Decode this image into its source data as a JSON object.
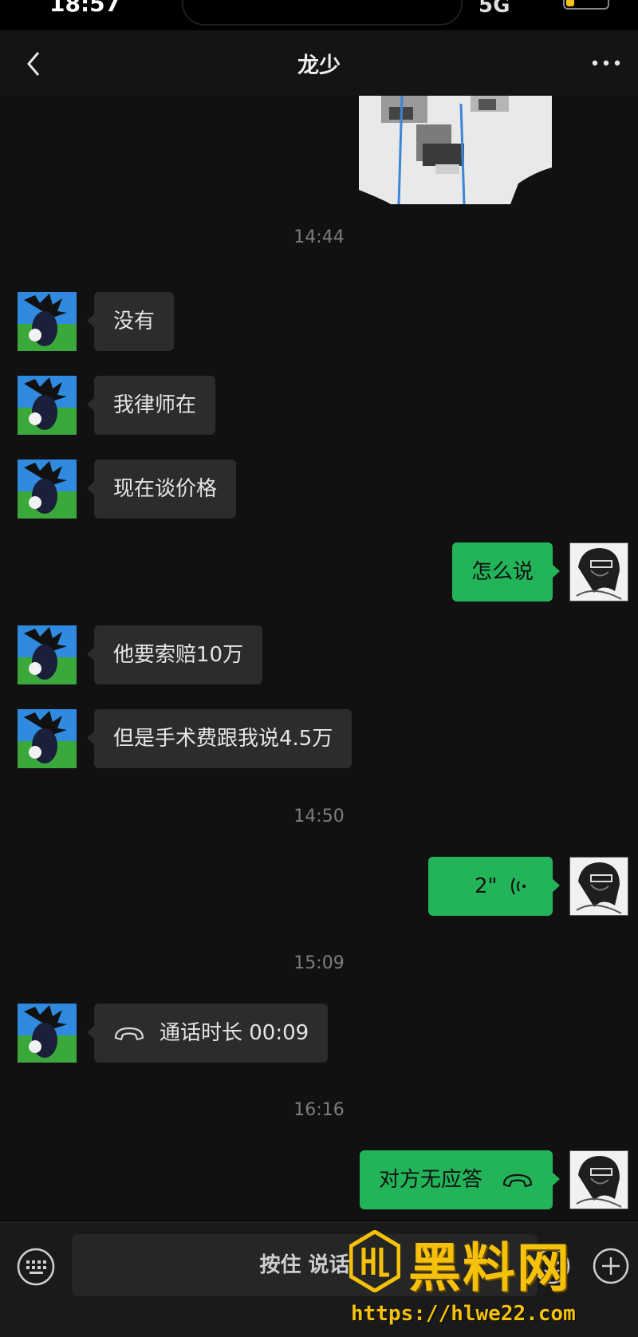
{
  "status_bar": {
    "time": "18:57",
    "network": "5G"
  },
  "header": {
    "title": "龙少"
  },
  "timestamps": [
    "14:44",
    "14:50",
    "15:09",
    "16:16"
  ],
  "messages": [
    {
      "side": "left",
      "text": "没有"
    },
    {
      "side": "left",
      "text": "我律师在"
    },
    {
      "side": "left",
      "text": "现在谈价格"
    },
    {
      "side": "right",
      "text": "怎么说"
    },
    {
      "side": "left",
      "text": "他要索赔10万"
    },
    {
      "side": "left",
      "text": "但是手术费跟我说4.5万"
    },
    {
      "side": "right",
      "type": "voice",
      "text": "2\""
    },
    {
      "side": "left",
      "type": "call",
      "text": "通话时长 00:09"
    },
    {
      "side": "right",
      "type": "call",
      "text": "对方无应答"
    }
  ],
  "input_bar": {
    "hold_to_talk": "按住 说话"
  },
  "watermark": {
    "brand": "黑料网",
    "url": "https://hlwe22.com"
  },
  "colors": {
    "bubble_self": "#23b45a",
    "bubble_other": "#2c2c2c",
    "background": "#111111",
    "watermark": "#f5c10a"
  }
}
